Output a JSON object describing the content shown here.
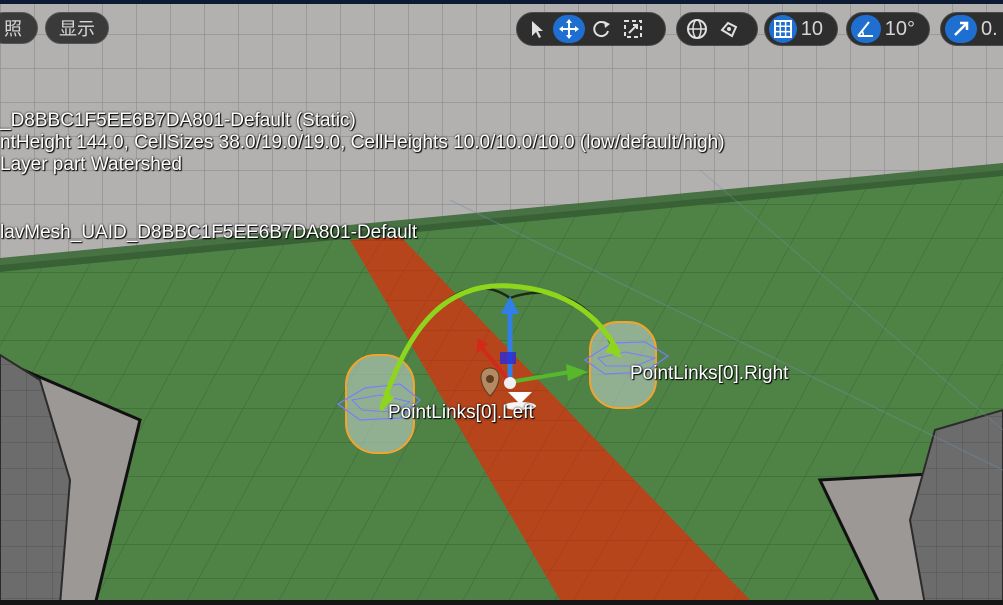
{
  "toolbar": {
    "left_buttons": [
      "照",
      "显示"
    ],
    "transform_tools": [
      "select-icon",
      "move-icon",
      "rotate-icon",
      "scale-icon"
    ],
    "coordinate_space_icon": "globe-icon",
    "surface_snap_icon": "surface-snap-icon",
    "grid_snap": {
      "icon": "grid-icon",
      "value": "10",
      "active": true
    },
    "rotation_snap": {
      "icon": "angle-icon",
      "value": "10°",
      "active": true
    },
    "scale_snap": {
      "icon": "scale-arrow-icon",
      "value": "0.",
      "active": true
    }
  },
  "overlay": {
    "line1": "_D8BBC1F5EE6B7DA801-Default (Static)",
    "line2": "ntHeight 144.0, CellSizes 38.0/19.0/19.0, CellHeights 10.0/10.0/10.0 (low/default/high)",
    "line3": " Layer part Watershed",
    "line4": "lavMesh_UAID_D8BBC1F5EE6B7DA801-Default"
  },
  "scene_labels": {
    "left_point": "PointLinks[0].Left",
    "right_point": "PointLinks[0].Right"
  },
  "colors": {
    "wall": "#b2b0ae",
    "floor": "#4d7f44",
    "navmesh_path": "#b6441a",
    "accent_blue": "#1f6fd1",
    "link_arc": "#8ed61e",
    "selection_orange": "#f2a42c"
  }
}
